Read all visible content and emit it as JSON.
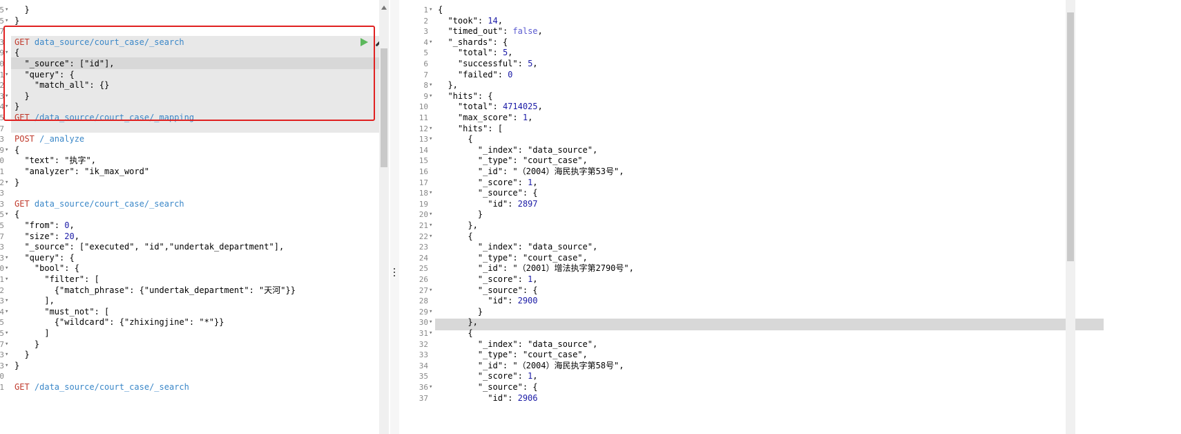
{
  "editor": {
    "left_lines": [
      {
        "n": "5",
        "fold": true,
        "parts": [
          [
            "p",
            "  }"
          ]
        ]
      },
      {
        "n": "5",
        "fold": true,
        "parts": [
          [
            "p",
            "}"
          ]
        ]
      },
      {
        "n": "7",
        "parts": []
      },
      {
        "n": "3",
        "parts": [
          [
            "m",
            "GET "
          ],
          [
            "u",
            "data_source/court_case/_search"
          ]
        ]
      },
      {
        "n": "9",
        "fold": true,
        "parts": [
          [
            "p",
            "{"
          ]
        ]
      },
      {
        "n": "0",
        "parts": [
          [
            "p",
            "  "
          ],
          [
            "k",
            "\"_source\""
          ],
          [
            "p",
            ": ["
          ],
          [
            "str",
            "\"id\""
          ],
          [
            "p",
            "], "
          ]
        ]
      },
      {
        "n": "1",
        "fold": true,
        "parts": [
          [
            "p",
            "  "
          ],
          [
            "k",
            "\"query\""
          ],
          [
            "p",
            ": {"
          ]
        ]
      },
      {
        "n": "2",
        "parts": [
          [
            "p",
            "    "
          ],
          [
            "k",
            "\"match_all\""
          ],
          [
            "p",
            ": {}"
          ]
        ]
      },
      {
        "n": "3",
        "fold": true,
        "parts": [
          [
            "p",
            "  }"
          ]
        ]
      },
      {
        "n": "4",
        "fold": true,
        "parts": [
          [
            "p",
            "}"
          ]
        ]
      },
      {
        "n": "5",
        "parts": [
          [
            "m",
            "GET "
          ],
          [
            "u",
            "/data_source/court_case/_mapping"
          ]
        ]
      },
      {
        "n": "7",
        "parts": []
      },
      {
        "n": "3",
        "parts": [
          [
            "m",
            "POST "
          ],
          [
            "u",
            "/_analyze"
          ]
        ]
      },
      {
        "n": "9",
        "fold": true,
        "parts": [
          [
            "p",
            "{"
          ]
        ]
      },
      {
        "n": "0",
        "parts": [
          [
            "p",
            "  "
          ],
          [
            "k",
            "\"text\""
          ],
          [
            "p",
            ": "
          ],
          [
            "str",
            "\"执字\""
          ],
          [
            "p",
            ","
          ]
        ]
      },
      {
        "n": "1",
        "parts": [
          [
            "p",
            "  "
          ],
          [
            "k",
            "\"analyzer\""
          ],
          [
            "p",
            ": "
          ],
          [
            "str",
            "\"ik_max_word\""
          ]
        ]
      },
      {
        "n": "2",
        "fold": true,
        "parts": [
          [
            "p",
            "}"
          ]
        ]
      },
      {
        "n": "3",
        "parts": []
      },
      {
        "n": "3",
        "parts": [
          [
            "m",
            "GET "
          ],
          [
            "u",
            "data_source/court_case/_search"
          ]
        ]
      },
      {
        "n": "5",
        "fold": true,
        "parts": [
          [
            "p",
            "{"
          ]
        ]
      },
      {
        "n": "5",
        "parts": [
          [
            "p",
            "  "
          ],
          [
            "k",
            "\"from\""
          ],
          [
            "p",
            ": "
          ],
          [
            "n",
            "0"
          ],
          [
            "p",
            ","
          ]
        ]
      },
      {
        "n": "7",
        "parts": [
          [
            "p",
            "  "
          ],
          [
            "k",
            "\"size\""
          ],
          [
            "p",
            ": "
          ],
          [
            "n",
            "20"
          ],
          [
            "p",
            ","
          ]
        ]
      },
      {
        "n": "3",
        "parts": [
          [
            "p",
            "  "
          ],
          [
            "k",
            "\"_source\""
          ],
          [
            "p",
            ": ["
          ],
          [
            "str",
            "\"executed\""
          ],
          [
            "p",
            ", "
          ],
          [
            "str",
            "\"id\""
          ],
          [
            "p",
            ","
          ],
          [
            "str",
            "\"undertak_department\""
          ],
          [
            "p",
            "],"
          ]
        ]
      },
      {
        "n": "3",
        "fold": true,
        "parts": [
          [
            "p",
            "  "
          ],
          [
            "k",
            "\"query\""
          ],
          [
            "p",
            ": {"
          ]
        ]
      },
      {
        "n": "0",
        "fold": true,
        "parts": [
          [
            "p",
            "    "
          ],
          [
            "k",
            "\"bool\""
          ],
          [
            "p",
            ": {"
          ]
        ]
      },
      {
        "n": "1",
        "fold": true,
        "parts": [
          [
            "p",
            "      "
          ],
          [
            "k",
            "\"filter\""
          ],
          [
            "p",
            ": ["
          ]
        ]
      },
      {
        "n": "2",
        "parts": [
          [
            "p",
            "        {"
          ],
          [
            "k",
            "\"match_phrase\""
          ],
          [
            "p",
            ": {"
          ],
          [
            "k",
            "\"undertak_department\""
          ],
          [
            "p",
            ": "
          ],
          [
            "str",
            "\"天河\""
          ],
          [
            "p",
            "}}"
          ]
        ]
      },
      {
        "n": "3",
        "fold": true,
        "parts": [
          [
            "p",
            "      ],"
          ]
        ]
      },
      {
        "n": "4",
        "fold": true,
        "parts": [
          [
            "p",
            "      "
          ],
          [
            "k",
            "\"must_not\""
          ],
          [
            "p",
            ": ["
          ]
        ]
      },
      {
        "n": "5",
        "parts": [
          [
            "p",
            "        {"
          ],
          [
            "k",
            "\"wildcard\""
          ],
          [
            "p",
            ": {"
          ],
          [
            "k",
            "\"zhixingjine\""
          ],
          [
            "p",
            ": "
          ],
          [
            "str",
            "\"*\""
          ],
          [
            "p",
            "}}"
          ]
        ]
      },
      {
        "n": "5",
        "fold": true,
        "parts": [
          [
            "p",
            "      ]"
          ]
        ]
      },
      {
        "n": "7",
        "fold": true,
        "parts": [
          [
            "p",
            "    }"
          ]
        ]
      },
      {
        "n": "3",
        "fold": true,
        "parts": [
          [
            "p",
            "  }"
          ]
        ]
      },
      {
        "n": "3",
        "fold": true,
        "parts": [
          [
            "p",
            "}"
          ]
        ]
      },
      {
        "n": "0",
        "parts": []
      },
      {
        "n": "1",
        "parts": [
          [
            "m",
            "GET "
          ],
          [
            "u",
            "/data_source/court_case/_search"
          ]
        ]
      }
    ],
    "right_lines": [
      {
        "n": "1",
        "fold": true,
        "parts": [
          [
            "p",
            "{"
          ]
        ]
      },
      {
        "n": "2",
        "parts": [
          [
            "p",
            "  "
          ],
          [
            "k",
            "\"took\""
          ],
          [
            "p",
            ": "
          ],
          [
            "n",
            "14"
          ],
          [
            "p",
            ","
          ]
        ]
      },
      {
        "n": "3",
        "parts": [
          [
            "p",
            "  "
          ],
          [
            "k",
            "\"timed_out\""
          ],
          [
            "p",
            ": "
          ],
          [
            "b",
            "false"
          ],
          [
            "p",
            ","
          ]
        ]
      },
      {
        "n": "4",
        "fold": true,
        "parts": [
          [
            "p",
            "  "
          ],
          [
            "k",
            "\"_shards\""
          ],
          [
            "p",
            ": {"
          ]
        ]
      },
      {
        "n": "5",
        "parts": [
          [
            "p",
            "    "
          ],
          [
            "k",
            "\"total\""
          ],
          [
            "p",
            ": "
          ],
          [
            "n",
            "5"
          ],
          [
            "p",
            ","
          ]
        ]
      },
      {
        "n": "6",
        "parts": [
          [
            "p",
            "    "
          ],
          [
            "k",
            "\"successful\""
          ],
          [
            "p",
            ": "
          ],
          [
            "n",
            "5"
          ],
          [
            "p",
            ","
          ]
        ]
      },
      {
        "n": "7",
        "parts": [
          [
            "p",
            "    "
          ],
          [
            "k",
            "\"failed\""
          ],
          [
            "p",
            ": "
          ],
          [
            "n",
            "0"
          ]
        ]
      },
      {
        "n": "8",
        "fold": true,
        "parts": [
          [
            "p",
            "  },"
          ]
        ]
      },
      {
        "n": "9",
        "fold": true,
        "parts": [
          [
            "p",
            "  "
          ],
          [
            "k",
            "\"hits\""
          ],
          [
            "p",
            ": {"
          ]
        ]
      },
      {
        "n": "10",
        "parts": [
          [
            "p",
            "    "
          ],
          [
            "k",
            "\"total\""
          ],
          [
            "p",
            ": "
          ],
          [
            "n",
            "4714025"
          ],
          [
            "p",
            ","
          ]
        ]
      },
      {
        "n": "11",
        "parts": [
          [
            "p",
            "    "
          ],
          [
            "k",
            "\"max_score\""
          ],
          [
            "p",
            ": "
          ],
          [
            "n",
            "1"
          ],
          [
            "p",
            ","
          ]
        ]
      },
      {
        "n": "12",
        "fold": true,
        "parts": [
          [
            "p",
            "    "
          ],
          [
            "k",
            "\"hits\""
          ],
          [
            "p",
            ": ["
          ]
        ]
      },
      {
        "n": "13",
        "fold": true,
        "parts": [
          [
            "p",
            "      {"
          ]
        ]
      },
      {
        "n": "14",
        "parts": [
          [
            "p",
            "        "
          ],
          [
            "k",
            "\"_index\""
          ],
          [
            "p",
            ": "
          ],
          [
            "str",
            "\"data_source\""
          ],
          [
            "p",
            ","
          ]
        ]
      },
      {
        "n": "15",
        "parts": [
          [
            "p",
            "        "
          ],
          [
            "k",
            "\"_type\""
          ],
          [
            "p",
            ": "
          ],
          [
            "str",
            "\"court_case\""
          ],
          [
            "p",
            ","
          ]
        ]
      },
      {
        "n": "16",
        "parts": [
          [
            "p",
            "        "
          ],
          [
            "k",
            "\"_id\""
          ],
          [
            "p",
            ": "
          ],
          [
            "str",
            "\"（2004）海民执字第53号\""
          ],
          [
            "p",
            ","
          ]
        ]
      },
      {
        "n": "17",
        "parts": [
          [
            "p",
            "        "
          ],
          [
            "k",
            "\"_score\""
          ],
          [
            "p",
            ": "
          ],
          [
            "n",
            "1"
          ],
          [
            "p",
            ","
          ]
        ]
      },
      {
        "n": "18",
        "fold": true,
        "parts": [
          [
            "p",
            "        "
          ],
          [
            "k",
            "\"_source\""
          ],
          [
            "p",
            ": {"
          ]
        ]
      },
      {
        "n": "19",
        "parts": [
          [
            "p",
            "          "
          ],
          [
            "k",
            "\"id\""
          ],
          [
            "p",
            ": "
          ],
          [
            "n",
            "2897"
          ]
        ]
      },
      {
        "n": "20",
        "fold": true,
        "parts": [
          [
            "p",
            "        }"
          ]
        ]
      },
      {
        "n": "21",
        "fold": true,
        "parts": [
          [
            "p",
            "      },"
          ]
        ]
      },
      {
        "n": "22",
        "fold": true,
        "parts": [
          [
            "p",
            "      {"
          ]
        ]
      },
      {
        "n": "23",
        "parts": [
          [
            "p",
            "        "
          ],
          [
            "k",
            "\"_index\""
          ],
          [
            "p",
            ": "
          ],
          [
            "str",
            "\"data_source\""
          ],
          [
            "p",
            ","
          ]
        ]
      },
      {
        "n": "24",
        "parts": [
          [
            "p",
            "        "
          ],
          [
            "k",
            "\"_type\""
          ],
          [
            "p",
            ": "
          ],
          [
            "str",
            "\"court_case\""
          ],
          [
            "p",
            ","
          ]
        ]
      },
      {
        "n": "25",
        "parts": [
          [
            "p",
            "        "
          ],
          [
            "k",
            "\"_id\""
          ],
          [
            "p",
            ": "
          ],
          [
            "str",
            "\"（2001）增法执字第2790号\""
          ],
          [
            "p",
            ","
          ]
        ]
      },
      {
        "n": "26",
        "parts": [
          [
            "p",
            "        "
          ],
          [
            "k",
            "\"_score\""
          ],
          [
            "p",
            ": "
          ],
          [
            "n",
            "1"
          ],
          [
            "p",
            ","
          ]
        ]
      },
      {
        "n": "27",
        "fold": true,
        "parts": [
          [
            "p",
            "        "
          ],
          [
            "k",
            "\"_source\""
          ],
          [
            "p",
            ": {"
          ]
        ]
      },
      {
        "n": "28",
        "parts": [
          [
            "p",
            "          "
          ],
          [
            "k",
            "\"id\""
          ],
          [
            "p",
            ": "
          ],
          [
            "n",
            "2900"
          ]
        ]
      },
      {
        "n": "29",
        "fold": true,
        "parts": [
          [
            "p",
            "        }"
          ]
        ]
      },
      {
        "n": "30",
        "fold": true,
        "parts": [
          [
            "p",
            "      },"
          ]
        ]
      },
      {
        "n": "31",
        "fold": true,
        "parts": [
          [
            "p",
            "      {"
          ]
        ]
      },
      {
        "n": "32",
        "parts": [
          [
            "p",
            "        "
          ],
          [
            "k",
            "\"_index\""
          ],
          [
            "p",
            ": "
          ],
          [
            "str",
            "\"data_source\""
          ],
          [
            "p",
            ","
          ]
        ]
      },
      {
        "n": "33",
        "parts": [
          [
            "p",
            "        "
          ],
          [
            "k",
            "\"_type\""
          ],
          [
            "p",
            ": "
          ],
          [
            "str",
            "\"court_case\""
          ],
          [
            "p",
            ","
          ]
        ]
      },
      {
        "n": "34",
        "parts": [
          [
            "p",
            "        "
          ],
          [
            "k",
            "\"_id\""
          ],
          [
            "p",
            ": "
          ],
          [
            "str",
            "\"（2004）海民执字第58号\""
          ],
          [
            "p",
            ","
          ]
        ]
      },
      {
        "n": "35",
        "parts": [
          [
            "p",
            "        "
          ],
          [
            "k",
            "\"_score\""
          ],
          [
            "p",
            ": "
          ],
          [
            "n",
            "1"
          ],
          [
            "p",
            ","
          ]
        ]
      },
      {
        "n": "36",
        "fold": true,
        "parts": [
          [
            "p",
            "        "
          ],
          [
            "k",
            "\"_source\""
          ],
          [
            "p",
            ": {"
          ]
        ]
      },
      {
        "n": "37",
        "parts": [
          [
            "p",
            "          "
          ],
          [
            "k",
            "\"id\""
          ],
          [
            "p",
            ": "
          ],
          [
            "n",
            "2906"
          ]
        ]
      }
    ],
    "accent_color": "#e02020",
    "run_icon": "play-icon",
    "settings_icon": "wrench-icon",
    "splitter_icon": "vertical-dots-icon"
  }
}
